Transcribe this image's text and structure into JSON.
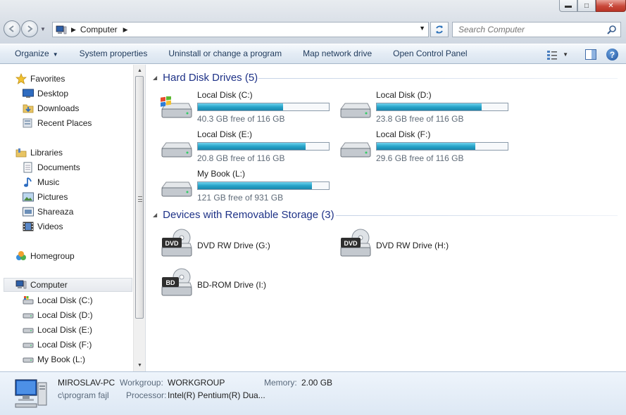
{
  "window": {
    "caption_min": "▬",
    "caption_max": "□",
    "caption_close": "✕"
  },
  "address": {
    "crumb": "Computer",
    "search_placeholder": "Search Computer"
  },
  "commands": {
    "organize": "Organize",
    "system_properties": "System properties",
    "uninstall": "Uninstall or change a program",
    "map_network": "Map network drive",
    "open_control_panel": "Open Control Panel",
    "help": "?"
  },
  "nav": {
    "favorites": "Favorites",
    "desktop": "Desktop",
    "downloads": "Downloads",
    "recent_places": "Recent Places",
    "libraries": "Libraries",
    "documents": "Documents",
    "music": "Music",
    "pictures": "Pictures",
    "shareaza": "Shareaza",
    "videos": "Videos",
    "homegroup": "Homegroup",
    "computer": "Computer",
    "local_c": "Local Disk (C:)",
    "local_d": "Local Disk (D:)",
    "local_e": "Local Disk (E:)",
    "local_f": "Local Disk (F:)",
    "mybook_l": "My Book (L:)"
  },
  "hard_disks": {
    "header": "Hard Disk Drives (5)",
    "drives": [
      {
        "name": "Local Disk (C:)",
        "free": "40.3 GB free of 116 GB",
        "used_fraction": 0.65
      },
      {
        "name": "Local Disk (D:)",
        "free": "23.8 GB free of 116 GB",
        "used_fraction": 0.8
      },
      {
        "name": "Local Disk (E:)",
        "free": "20.8 GB free of 116 GB",
        "used_fraction": 0.82
      },
      {
        "name": "Local Disk (F:)",
        "free": "29.6 GB free of 116 GB",
        "used_fraction": 0.75
      },
      {
        "name": "My Book (L:)",
        "free": "121 GB free of 931 GB",
        "used_fraction": 0.87
      }
    ]
  },
  "removable": {
    "header": "Devices with Removable Storage (3)",
    "devices": [
      {
        "name": "DVD RW Drive (G:)",
        "label": "DVD"
      },
      {
        "name": "DVD RW Drive (H:)",
        "label": "DVD"
      },
      {
        "name": "BD-ROM Drive (I:)",
        "label": "BD"
      }
    ]
  },
  "details": {
    "pc_name": "MIROSLAV-PC",
    "workgroup_label": "Workgroup:",
    "workgroup_value": "WORKGROUP",
    "memory_label": "Memory:",
    "memory_value": "2.00 GB",
    "description": "c\\program fajl",
    "processor_label": "Processor:",
    "processor_value": "Intel(R) Pentium(R) Dua..."
  },
  "colors": {
    "accent_header": "#1e3287",
    "bar_fill": "#27a4c9"
  }
}
